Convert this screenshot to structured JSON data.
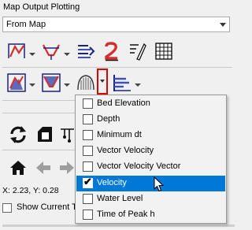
{
  "panel": {
    "title": "Map Output Plotting"
  },
  "source_select": {
    "value": "From Map"
  },
  "coordinates": "X: 2.23, Y: 0.28",
  "show_current": {
    "label": "Show Current Ti",
    "checked": false
  },
  "menu": {
    "items": [
      {
        "label": "Bed Elevation",
        "checked": false
      },
      {
        "label": "Depth",
        "checked": false
      },
      {
        "label": "Minimum dt",
        "checked": false
      },
      {
        "label": "Vector Velocity",
        "checked": false
      },
      {
        "label": "Vector Velocity Vector",
        "checked": false
      },
      {
        "label": "Velocity",
        "checked": true
      },
      {
        "label": "Water Level",
        "checked": false
      },
      {
        "label": "Time of Peak h",
        "checked": false
      }
    ],
    "selected_index": 5
  },
  "colors": {
    "accent": "#0078d7",
    "highlight": "#e00000"
  }
}
